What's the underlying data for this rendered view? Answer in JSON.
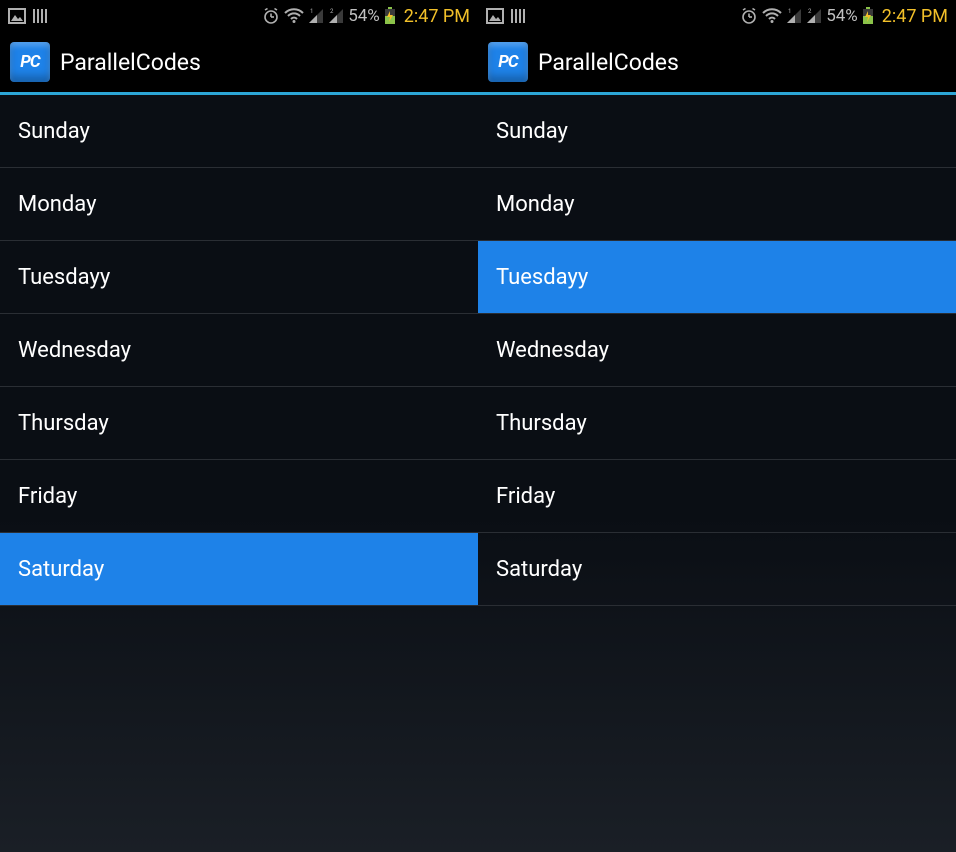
{
  "status_bar": {
    "battery_pct": "54%",
    "time": "2:47 PM"
  },
  "app": {
    "icon_text": "PC",
    "title": "ParallelCodes"
  },
  "screens": [
    {
      "items": [
        {
          "label": "Sunday",
          "selected": false
        },
        {
          "label": "Monday",
          "selected": false
        },
        {
          "label": "Tuesdayy",
          "selected": false
        },
        {
          "label": "Wednesday",
          "selected": false
        },
        {
          "label": "Thursday",
          "selected": false
        },
        {
          "label": "Friday",
          "selected": false
        },
        {
          "label": "Saturday",
          "selected": true
        }
      ]
    },
    {
      "items": [
        {
          "label": "Sunday",
          "selected": false
        },
        {
          "label": "Monday",
          "selected": false
        },
        {
          "label": "Tuesdayy",
          "selected": true
        },
        {
          "label": "Wednesday",
          "selected": false
        },
        {
          "label": "Thursday",
          "selected": false
        },
        {
          "label": "Friday",
          "selected": false
        },
        {
          "label": "Saturday",
          "selected": false
        }
      ]
    }
  ]
}
